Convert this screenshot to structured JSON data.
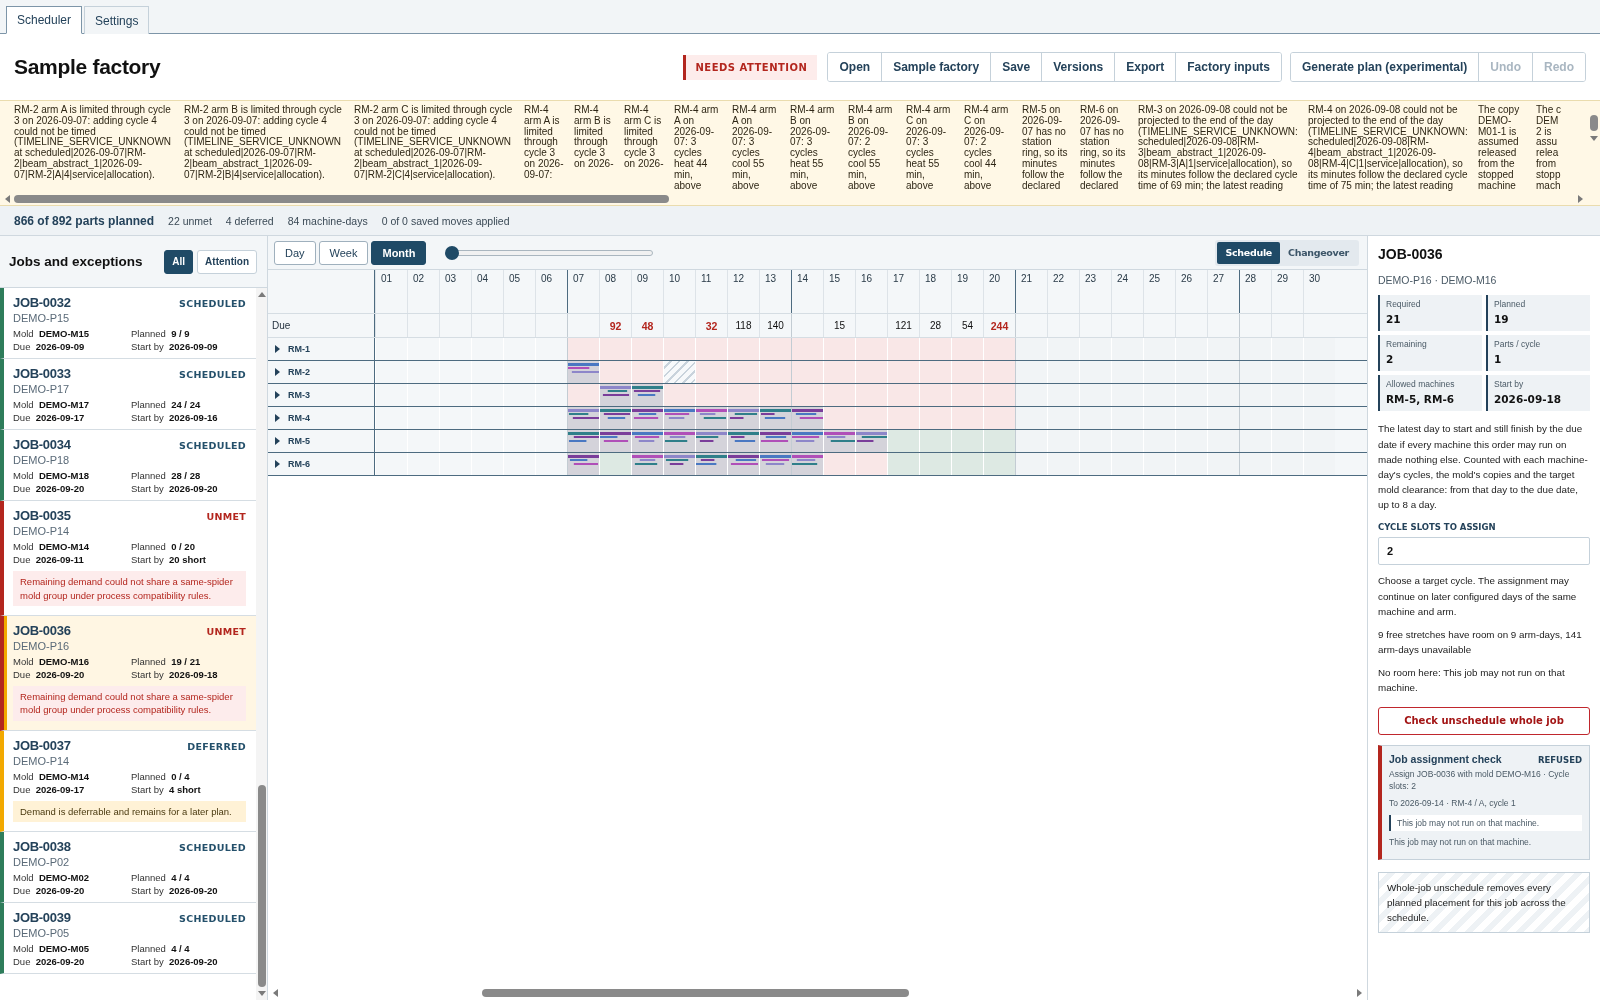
{
  "tabs": [
    {
      "label": "Scheduler",
      "selected": true
    },
    {
      "label": "Settings",
      "selected": false
    }
  ],
  "header": {
    "title": "Sample factory",
    "status": "NEEDS ATTENTION",
    "file_actions": [
      {
        "label": "Open",
        "disabled": false
      },
      {
        "label": "Sample factory",
        "disabled": false
      },
      {
        "label": "Save",
        "disabled": false
      },
      {
        "label": "Versions",
        "disabled": false
      },
      {
        "label": "Export",
        "disabled": false
      },
      {
        "label": "Factory inputs",
        "disabled": false
      }
    ],
    "plan_actions": [
      {
        "label": "Generate plan (experimental)",
        "disabled": false
      },
      {
        "label": "Undo",
        "disabled": true
      },
      {
        "label": "Redo",
        "disabled": true
      }
    ]
  },
  "warnings": [
    {
      "kind": "wide",
      "text": "RM-2 arm A is limited through cycle 3 on 2026-09-07: adding cycle 4 could not be timed (TIMELINE_SERVICE_UNKNOWN at scheduled|2026-09-07|RM-2|beam_abstract_1|2026-09-07|RM-2|A|4|service|allocation)."
    },
    {
      "kind": "wide",
      "text": "RM-2 arm B is limited through cycle 3 on 2026-09-07: adding cycle 4 could not be timed (TIMELINE_SERVICE_UNKNOWN at scheduled|2026-09-07|RM-2|beam_abstract_1|2026-09-07|RM-2|B|4|service|allocation)."
    },
    {
      "kind": "wide",
      "text": "RM-2 arm C is limited through cycle 3 on 2026-09-07: adding cycle 4 could not be timed (TIMELINE_SERVICE_UNKNOWN at scheduled|2026-09-07|RM-2|beam_abstract_1|2026-09-07|RM-2|C|4|service|allocation)."
    },
    {
      "kind": "narrow",
      "text": "RM-4 arm A is limited through cycle 3 on 2026-09-07:"
    },
    {
      "kind": "narrow",
      "text": "RM-4 arm B is limited through cycle 3 on 2026-"
    },
    {
      "kind": "narrow",
      "text": "RM-4 arm C is limited through cycle 3 on 2026-"
    },
    {
      "kind": "medium",
      "text": "RM-4 arm A on 2026-09-07: 3 cycles heat 44 min, above"
    },
    {
      "kind": "medium",
      "text": "RM-4 arm A on 2026-09-07: 3 cycles cool 55 min, above"
    },
    {
      "kind": "medium",
      "text": "RM-4 arm B on 2026-09-07: 3 cycles heat 55 min, above"
    },
    {
      "kind": "medium",
      "text": "RM-4 arm B on 2026-09-07: 2 cycles cool 55 min, above"
    },
    {
      "kind": "medium",
      "text": "RM-4 arm C on 2026-09-07: 3 cycles heat 55 min, above"
    },
    {
      "kind": "medium",
      "text": "RM-4 arm C on 2026-09-07: 2 cycles cool 44 min, above"
    },
    {
      "kind": "medium",
      "text": "RM-5 on 2026-09-07 has no station ring, so its minutes follow the declared"
    },
    {
      "kind": "medium",
      "text": "RM-6 on 2026-09-07 has no station ring, so its minutes follow the declared"
    },
    {
      "kind": "wide",
      "text": "RM-3 on 2026-09-08 could not be projected to the end of the day (TIMELINE_SERVICE_UNKNOWN: scheduled|2026-09-08|RM-3|beam_abstract_1|2026-09-08|RM-3|A|1|service|allocation), so its minutes follow the declared cycle time of 69 min; the latest reading"
    },
    {
      "kind": "wide",
      "text": "RM-4 on 2026-09-08 could not be projected to the end of the day (TIMELINE_SERVICE_UNKNOWN: scheduled|2026-09-08|RM-4|beam_abstract_1|2026-09-08|RM-4|C|1|service|allocation), so its minutes follow the declared cycle time of 75 min; the latest reading"
    },
    {
      "kind": "medium",
      "text": "The copy DEMO-M01-1 is assumed released from the stopped machine"
    },
    {
      "kind": "cut",
      "text": "The c\nDEM\n2 is\nassu\nrelea\nfrom\nstopp\nmach"
    }
  ],
  "summary": {
    "planned": "866 of 892 parts planned",
    "items": [
      "22 unmet",
      "4 deferred",
      "84 machine-days",
      "0 of 0 saved moves applied"
    ]
  },
  "jobs_panel": {
    "title": "Jobs and exceptions",
    "filters": [
      {
        "label": "All",
        "selected": true
      },
      {
        "label": "Attention",
        "selected": false
      }
    ],
    "jobs": [
      {
        "id": "JOB-0032",
        "part": "DEMO-P15",
        "status": "SCHEDULED",
        "kind": "scheduled",
        "selected": false,
        "fields": [
          {
            "label": "Mold",
            "value": "DEMO-M15"
          },
          {
            "label": "Planned",
            "value": "9 / 9"
          },
          {
            "label": "Due",
            "value": "2026-09-09"
          },
          {
            "label": "Start by",
            "value": "2026-09-09"
          }
        ]
      },
      {
        "id": "JOB-0033",
        "part": "DEMO-P17",
        "status": "SCHEDULED",
        "kind": "scheduled",
        "selected": false,
        "fields": [
          {
            "label": "Mold",
            "value": "DEMO-M17"
          },
          {
            "label": "Planned",
            "value": "24 / 24"
          },
          {
            "label": "Due",
            "value": "2026-09-17"
          },
          {
            "label": "Start by",
            "value": "2026-09-16"
          }
        ]
      },
      {
        "id": "JOB-0034",
        "part": "DEMO-P18",
        "status": "SCHEDULED",
        "kind": "scheduled",
        "selected": false,
        "fields": [
          {
            "label": "Mold",
            "value": "DEMO-M18"
          },
          {
            "label": "Planned",
            "value": "28 / 28"
          },
          {
            "label": "Due",
            "value": "2026-09-20"
          },
          {
            "label": "Start by",
            "value": "2026-09-20"
          }
        ]
      },
      {
        "id": "JOB-0035",
        "part": "DEMO-P14",
        "status": "UNMET",
        "kind": "unmet",
        "selected": false,
        "fields": [
          {
            "label": "Mold",
            "value": "DEMO-M14"
          },
          {
            "label": "Planned",
            "value": "0 / 20"
          },
          {
            "label": "Due",
            "value": "2026-09-11"
          },
          {
            "label": "Start by",
            "value": "20 short"
          }
        ],
        "note": "Remaining demand could not share a same-spider mold group under process compatibility rules."
      },
      {
        "id": "JOB-0036",
        "part": "DEMO-P16",
        "status": "UNMET",
        "kind": "unmet",
        "selected": true,
        "fields": [
          {
            "label": "Mold",
            "value": "DEMO-M16"
          },
          {
            "label": "Planned",
            "value": "19 / 21"
          },
          {
            "label": "Due",
            "value": "2026-09-20"
          },
          {
            "label": "Start by",
            "value": "2026-09-18"
          }
        ],
        "note": "Remaining demand could not share a same-spider mold group under process compatibility rules."
      },
      {
        "id": "JOB-0037",
        "part": "DEMO-P14",
        "status": "DEFERRED",
        "kind": "deferred",
        "selected": false,
        "fields": [
          {
            "label": "Mold",
            "value": "DEMO-M14"
          },
          {
            "label": "Planned",
            "value": "0 / 4"
          },
          {
            "label": "Due",
            "value": "2026-09-17"
          },
          {
            "label": "Start by",
            "value": "4 short"
          }
        ],
        "note": "Demand is deferrable and remains for a later plan."
      },
      {
        "id": "JOB-0038",
        "part": "DEMO-P02",
        "status": "SCHEDULED",
        "kind": "scheduled",
        "selected": false,
        "fields": [
          {
            "label": "Mold",
            "value": "DEMO-M02"
          },
          {
            "label": "Planned",
            "value": "4 / 4"
          },
          {
            "label": "Due",
            "value": "2026-09-20"
          },
          {
            "label": "Start by",
            "value": "2026-09-20"
          }
        ]
      },
      {
        "id": "JOB-0039",
        "part": "DEMO-P05",
        "status": "SCHEDULED",
        "kind": "scheduled",
        "selected": false,
        "fields": [
          {
            "label": "Mold",
            "value": "DEMO-M05"
          },
          {
            "label": "Planned",
            "value": "4 / 4"
          },
          {
            "label": "Due",
            "value": "2026-09-20"
          },
          {
            "label": "Start by",
            "value": "2026-09-20"
          }
        ]
      }
    ]
  },
  "timeline": {
    "zoom": [
      {
        "label": "Day",
        "selected": false
      },
      {
        "label": "Week",
        "selected": false
      },
      {
        "label": "Month",
        "selected": true
      }
    ],
    "range_slider": {
      "level": 0
    },
    "views": [
      {
        "label": "Schedule",
        "selected": true
      },
      {
        "label": "Changeover",
        "selected": false
      }
    ],
    "due_label": "Due",
    "days": [
      {
        "label": "01"
      },
      {
        "label": "02"
      },
      {
        "label": "03"
      },
      {
        "label": "04"
      },
      {
        "label": "05"
      },
      {
        "label": "06"
      },
      {
        "label": "07"
      },
      {
        "label": "08",
        "due": "92",
        "late": true
      },
      {
        "label": "09",
        "due": "48",
        "late": true
      },
      {
        "label": "10"
      },
      {
        "label": "11",
        "due": "32",
        "late": true
      },
      {
        "label": "12",
        "due": "118",
        "late": false
      },
      {
        "label": "13",
        "due": "140",
        "late": false
      },
      {
        "label": "14"
      },
      {
        "label": "15",
        "due": "15",
        "late": false
      },
      {
        "label": "16"
      },
      {
        "label": "17",
        "due": "121",
        "late": false
      },
      {
        "label": "18",
        "due": "28",
        "late": false
      },
      {
        "label": "19",
        "due": "54",
        "late": false
      },
      {
        "label": "20",
        "due": "244",
        "late": true
      },
      {
        "label": "21"
      },
      {
        "label": "22"
      },
      {
        "label": "23"
      },
      {
        "label": "24"
      },
      {
        "label": "25"
      },
      {
        "label": "26"
      },
      {
        "label": "27"
      },
      {
        "label": "28"
      },
      {
        "label": "29"
      },
      {
        "label": "30"
      }
    ],
    "machines": [
      {
        "name": "RM-1",
        "expanded": false,
        "cells": [
          {
            "kind": "none"
          },
          {
            "kind": "none"
          },
          {
            "kind": "none"
          },
          {
            "kind": "none"
          },
          {
            "kind": "none"
          },
          {
            "kind": "none"
          },
          {
            "kind": "blocked"
          },
          {
            "kind": "blocked"
          },
          {
            "kind": "blocked"
          },
          {
            "kind": "blocked"
          },
          {
            "kind": "blocked"
          },
          {
            "kind": "blocked"
          },
          {
            "kind": "blocked"
          },
          {
            "kind": "blocked"
          },
          {
            "kind": "blocked"
          },
          {
            "kind": "blocked"
          },
          {
            "kind": "blocked"
          },
          {
            "kind": "blocked"
          },
          {
            "kind": "blocked"
          },
          {
            "kind": "blocked"
          },
          {
            "kind": "later"
          },
          {
            "kind": "later"
          },
          {
            "kind": "later"
          },
          {
            "kind": "later"
          },
          {
            "kind": "later"
          },
          {
            "kind": "later"
          },
          {
            "kind": "later"
          },
          {
            "kind": "later"
          },
          {
            "kind": "later"
          },
          {
            "kind": "later"
          }
        ]
      },
      {
        "name": "RM-2",
        "expanded": false,
        "cells": [
          {
            "kind": "none"
          },
          {
            "kind": "none"
          },
          {
            "kind": "none"
          },
          {
            "kind": "none"
          },
          {
            "kind": "none"
          },
          {
            "kind": "none"
          },
          {
            "kind": "busy"
          },
          {
            "kind": "blocked"
          },
          {
            "kind": "blocked"
          },
          {
            "kind": "hatched"
          },
          {
            "kind": "blocked"
          },
          {
            "kind": "blocked"
          },
          {
            "kind": "blocked"
          },
          {
            "kind": "blocked"
          },
          {
            "kind": "blocked"
          },
          {
            "kind": "blocked"
          },
          {
            "kind": "blocked"
          },
          {
            "kind": "blocked"
          },
          {
            "kind": "blocked"
          },
          {
            "kind": "blocked"
          },
          {
            "kind": "later"
          },
          {
            "kind": "later"
          },
          {
            "kind": "later"
          },
          {
            "kind": "later"
          },
          {
            "kind": "later"
          },
          {
            "kind": "later"
          },
          {
            "kind": "later"
          },
          {
            "kind": "later"
          },
          {
            "kind": "later"
          },
          {
            "kind": "later"
          }
        ]
      },
      {
        "name": "RM-3",
        "expanded": false,
        "cells": [
          {
            "kind": "none"
          },
          {
            "kind": "none"
          },
          {
            "kind": "none"
          },
          {
            "kind": "none"
          },
          {
            "kind": "none"
          },
          {
            "kind": "none"
          },
          {
            "kind": "blocked"
          },
          {
            "kind": "busy"
          },
          {
            "kind": "busy"
          },
          {
            "kind": "blocked"
          },
          {
            "kind": "blocked"
          },
          {
            "kind": "blocked"
          },
          {
            "kind": "blocked"
          },
          {
            "kind": "blocked"
          },
          {
            "kind": "blocked"
          },
          {
            "kind": "blocked"
          },
          {
            "kind": "blocked"
          },
          {
            "kind": "blocked"
          },
          {
            "kind": "blocked"
          },
          {
            "kind": "blocked"
          },
          {
            "kind": "later"
          },
          {
            "kind": "later"
          },
          {
            "kind": "later"
          },
          {
            "kind": "later"
          },
          {
            "kind": "later"
          },
          {
            "kind": "later"
          },
          {
            "kind": "later"
          },
          {
            "kind": "later"
          },
          {
            "kind": "later"
          },
          {
            "kind": "later"
          }
        ]
      },
      {
        "name": "RM-4",
        "expanded": false,
        "cells": [
          {
            "kind": "none"
          },
          {
            "kind": "none"
          },
          {
            "kind": "none"
          },
          {
            "kind": "none"
          },
          {
            "kind": "none"
          },
          {
            "kind": "none"
          },
          {
            "kind": "busy"
          },
          {
            "kind": "busy"
          },
          {
            "kind": "busy"
          },
          {
            "kind": "busy"
          },
          {
            "kind": "busy"
          },
          {
            "kind": "busy"
          },
          {
            "kind": "busy"
          },
          {
            "kind": "busy"
          },
          {
            "kind": "blocked"
          },
          {
            "kind": "blocked"
          },
          {
            "kind": "blocked"
          },
          {
            "kind": "blocked"
          },
          {
            "kind": "blocked"
          },
          {
            "kind": "blocked"
          },
          {
            "kind": "later"
          },
          {
            "kind": "later"
          },
          {
            "kind": "later"
          },
          {
            "kind": "later"
          },
          {
            "kind": "later"
          },
          {
            "kind": "later"
          },
          {
            "kind": "later"
          },
          {
            "kind": "later"
          },
          {
            "kind": "later"
          },
          {
            "kind": "later"
          }
        ]
      },
      {
        "name": "RM-5",
        "expanded": false,
        "cells": [
          {
            "kind": "none"
          },
          {
            "kind": "none"
          },
          {
            "kind": "none"
          },
          {
            "kind": "none"
          },
          {
            "kind": "none"
          },
          {
            "kind": "none"
          },
          {
            "kind": "busy"
          },
          {
            "kind": "busy"
          },
          {
            "kind": "busy"
          },
          {
            "kind": "busy"
          },
          {
            "kind": "busy"
          },
          {
            "kind": "busy"
          },
          {
            "kind": "busy"
          },
          {
            "kind": "busy"
          },
          {
            "kind": "busy"
          },
          {
            "kind": "busy"
          },
          {
            "kind": "open"
          },
          {
            "kind": "open"
          },
          {
            "kind": "open"
          },
          {
            "kind": "open"
          },
          {
            "kind": "later"
          },
          {
            "kind": "later"
          },
          {
            "kind": "later"
          },
          {
            "kind": "later"
          },
          {
            "kind": "later"
          },
          {
            "kind": "later"
          },
          {
            "kind": "later"
          },
          {
            "kind": "later"
          },
          {
            "kind": "later"
          },
          {
            "kind": "later"
          }
        ]
      },
      {
        "name": "RM-6",
        "expanded": false,
        "cells": [
          {
            "kind": "none"
          },
          {
            "kind": "none"
          },
          {
            "kind": "none"
          },
          {
            "kind": "none"
          },
          {
            "kind": "none"
          },
          {
            "kind": "none"
          },
          {
            "kind": "busy"
          },
          {
            "kind": "open"
          },
          {
            "kind": "busy"
          },
          {
            "kind": "busy"
          },
          {
            "kind": "busy"
          },
          {
            "kind": "busy"
          },
          {
            "kind": "busy"
          },
          {
            "kind": "busy"
          },
          {
            "kind": "blocked"
          },
          {
            "kind": "blocked"
          },
          {
            "kind": "open"
          },
          {
            "kind": "open"
          },
          {
            "kind": "open"
          },
          {
            "kind": "open"
          },
          {
            "kind": "later"
          },
          {
            "kind": "later"
          },
          {
            "kind": "later"
          },
          {
            "kind": "later"
          },
          {
            "kind": "later"
          },
          {
            "kind": "later"
          },
          {
            "kind": "later"
          },
          {
            "kind": "later"
          },
          {
            "kind": "later"
          },
          {
            "kind": "later"
          }
        ]
      }
    ]
  },
  "detail": {
    "title": "JOB-0036",
    "subtitle": "DEMO-P16 · DEMO-M16",
    "stats": [
      {
        "label": "Required",
        "value": "21"
      },
      {
        "label": "Planned",
        "value": "19"
      },
      {
        "label": "Remaining",
        "value": "2"
      },
      {
        "label": "Parts / cycle",
        "value": "1"
      },
      {
        "label": "Allowed machines",
        "value": "RM-5, RM-6"
      },
      {
        "label": "Start by",
        "value": "2026-09-18"
      }
    ],
    "explanation": "The latest day to start and still finish by the due date if every machine this order may run on made nothing else. Counted with each machine-day's cycles, the mold's copies and the target mold clearance: from that day to the due date, up to 8 a day.",
    "slots_label": "CYCLE SLOTS TO ASSIGN",
    "slots_value": "2",
    "hints": [
      "Choose a target cycle. The assignment may continue on later configured days of the same machine and arm.",
      "9 free stretches have room on 9 arm-days, 141 arm-days unavailable",
      "No room here: This job may not run on that machine."
    ],
    "unschedule_button": "Check unschedule whole job",
    "check": {
      "title": "Job assignment check",
      "verdict": "REFUSED",
      "lines": [
        "Assign JOB-0036 with mold DEMO-M16 · Cycle slots: 2",
        "To 2026-09-14 · RM-4 / A, cycle 1"
      ],
      "quote": "This job may not run on that machine.",
      "reason": "This job may not run on that machine."
    },
    "note": "Whole-job unschedule removes every planned placement for this job across the schedule."
  }
}
